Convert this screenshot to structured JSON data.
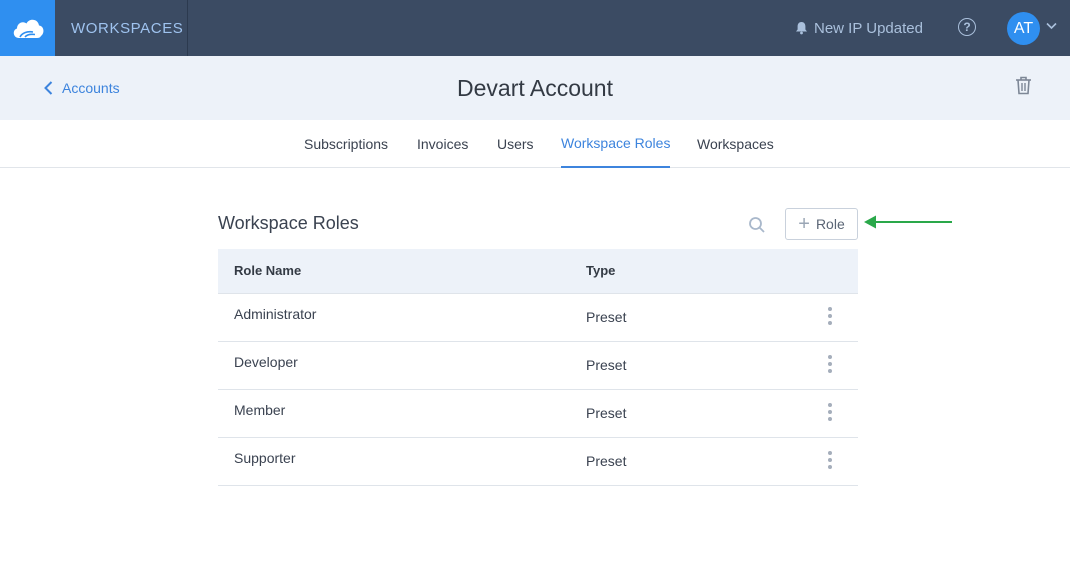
{
  "topbar": {
    "brand": "WORKSPACES",
    "notification": "New IP Updated",
    "help_symbol": "?",
    "avatar_initials": "AT",
    "icons": [
      "cloud-logo-icon",
      "bell-icon",
      "help-icon",
      "chevron-down-icon"
    ]
  },
  "header": {
    "back_label": "Accounts",
    "title": "Devart Account",
    "icons": [
      "chevron-left-icon",
      "trash-icon"
    ]
  },
  "tabs": [
    {
      "label": "Subscriptions",
      "active": false
    },
    {
      "label": "Invoices",
      "active": false
    },
    {
      "label": "Users",
      "active": false
    },
    {
      "label": "Workspace Roles",
      "active": true
    },
    {
      "label": "Workspaces",
      "active": false
    }
  ],
  "section": {
    "title": "Workspace Roles",
    "add_button_label": "Role",
    "add_button_symbol": "+",
    "icons": [
      "search-icon",
      "plus-icon",
      "green-arrow-annotation"
    ]
  },
  "table": {
    "columns": [
      "Role Name",
      "Type"
    ],
    "rows": [
      {
        "name": "Administrator",
        "type": "Preset"
      },
      {
        "name": "Developer",
        "type": "Preset"
      },
      {
        "name": "Member",
        "type": "Preset"
      },
      {
        "name": "Supporter",
        "type": "Preset"
      }
    ]
  },
  "colors": {
    "topbar": "#3b4b63",
    "logo_bg": "#2f8ff0",
    "accent": "#3d84dd",
    "header_bg": "#edf2f9",
    "annotation_arrow": "#2aa84a"
  }
}
